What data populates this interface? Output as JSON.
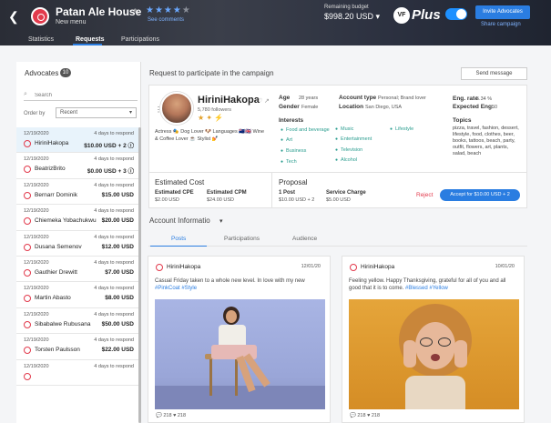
{
  "header": {
    "brand_name": "Patan Ale House",
    "brand_sub": "New menu",
    "rating_stars": "★★★★",
    "rating_off": "★",
    "see_comments": "See comments",
    "budget_label": "Remaining budget",
    "budget_value": "$998.20 USD ▾",
    "plus_mark": "VF",
    "plus_word": "Plus",
    "invite_label": "Invite Advocates",
    "share_label": "Share campaign",
    "tabs": [
      "Statistics",
      "Requests",
      "Participations"
    ]
  },
  "left": {
    "title": "Advocates",
    "count": "10",
    "search_placeholder": "Search",
    "order_by_label": "Order by",
    "order_by_value": "Recent",
    "advocates": [
      {
        "date": "12/19/2020",
        "days": "4 days to respond",
        "name": "HiriniHakopa",
        "amount": "$10.00 USD + 2 ⓘ",
        "selected": true
      },
      {
        "date": "12/19/2020",
        "days": "4 days to respond",
        "name": "BeatrizBrito",
        "amount": "$0.00 USD + 3 ⓘ",
        "selected": false
      },
      {
        "date": "12/19/2020",
        "days": "4 days to respond",
        "name": "Bernarr Dominik",
        "amount": "$15.00 USD",
        "selected": false
      },
      {
        "date": "12/19/2020",
        "days": "4 days to respond",
        "name": "Chiemeka Yobachukwu",
        "amount": "$20.00 USD",
        "selected": false
      },
      {
        "date": "12/19/2020",
        "days": "4 days to respond",
        "name": "Dusana Semenov",
        "amount": "$12.00 USD",
        "selected": false
      },
      {
        "date": "12/19/2020",
        "days": "4 days to respond",
        "name": "Gauthier Drewitt",
        "amount": "$7.00 USD",
        "selected": false
      },
      {
        "date": "12/19/2020",
        "days": "4 days to respond",
        "name": "Martin Abasto",
        "amount": "$8.00 USD",
        "selected": false
      },
      {
        "date": "12/19/2020",
        "days": "4 days to respond",
        "name": "Sibabalwe Rubusana",
        "amount": "$50.00 USD",
        "selected": false
      },
      {
        "date": "12/19/2020",
        "days": "4 days to respond",
        "name": "Torsten Paulsson",
        "amount": "$22.00 USD",
        "selected": false
      },
      {
        "date": "12/19/2020",
        "days": "4 days to respond",
        "name": "",
        "amount": "",
        "selected": false
      }
    ]
  },
  "main": {
    "title": "Request to participate in the campaign",
    "send_message": "Send message",
    "profile": {
      "name": "HiriniHakopa",
      "followers": "5,780 followers",
      "bio": "Actress 🎭 Dog Lover 🐶 Languages 🇳🇿🇬🇧 Wine & Coffee Lover ☕ Stylist 💅",
      "age_label": "Age",
      "age_value": "28 years",
      "gender_label": "Gender",
      "gender_value": "Female",
      "account_type_label": "Account type",
      "account_type_value": "Personal; Brand lover",
      "location_label": "Location",
      "location_value": "San Diego, USA",
      "eng_rate_label": "Eng. rate",
      "eng_rate_value": "5.34 %",
      "expected_eng_label": "Expected Eng.",
      "expected_eng_value": "50",
      "interests_label": "Interests",
      "interests": [
        "Food and beverage",
        "Art",
        "Business",
        "Tech",
        "Music",
        "Entertainment",
        "Television",
        "Alcohol",
        "Lifestyle"
      ],
      "topics_label": "Topics",
      "topics": "pizza, travel, fashion, dessert, lifestyle, food, clothes, beer, books, tattoos, beach, party, outfit, flowers, art, plants, salad, beach"
    },
    "cost": {
      "title": "Estimated Cost",
      "cpe_label": "Estimated CPE",
      "cpe_value": "$2.00 USD",
      "cpm_label": "Estimated CPM",
      "cpm_value": "$24.00 USD"
    },
    "proposal": {
      "title": "Proposal",
      "post_label": "1 Post",
      "post_value": "$10.00 USD + 2",
      "service_label": "Service Charge",
      "service_value": "$5.00 USD",
      "reject_label": "Reject",
      "accept_label": "Accept for $10.00 USD + 2"
    },
    "account_info_title": "Account Informatio",
    "subtabs": [
      "Posts",
      "Participations",
      "Audience"
    ],
    "posts": [
      {
        "name": "HiriniHakopa",
        "date": "12/01/20",
        "text": "Casual Friday taken to a whole new level. In love with my new",
        "tags": "#PinkCoat #Style",
        "stats": "💬 218  ♥ 218"
      },
      {
        "name": "HiriniHakopa",
        "date": "10/01/20",
        "text": "Feeling yellow. Happy Thanksgiving, grateful for all of you and all good that it is to come.",
        "tags": "#Blessed #Yellow",
        "stats": "💬 218  ♥ 218"
      }
    ]
  },
  "colors": {
    "accent": "#2a7de1",
    "instagram": "#e23a4c",
    "interest": "#2a9d8f",
    "reject": "#e23a4c"
  }
}
